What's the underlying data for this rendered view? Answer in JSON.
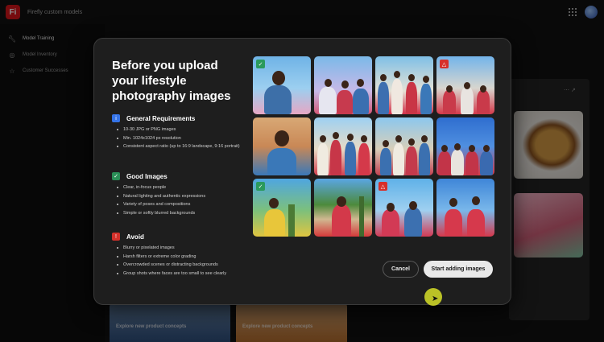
{
  "app": {
    "logo_text": "Fi",
    "title": "Firefly custom models"
  },
  "sidebar": {
    "items": [
      {
        "label": "Model Training",
        "icon": "wrench-icon",
        "active": true
      },
      {
        "label": "Model Inventory",
        "icon": "cube-icon",
        "active": false
      },
      {
        "label": "Customer Successes",
        "icon": "star-icon",
        "active": false
      }
    ]
  },
  "background": {
    "cards": [
      {
        "title": "Explore new product concepts"
      },
      {
        "title": "Explore new product concepts"
      }
    ]
  },
  "modal": {
    "title": "Before you upload your lifestyle photography images",
    "sections": [
      {
        "title": "General Requirements",
        "icon": "info-icon",
        "color": "#3574e8",
        "items": [
          "10-30 JPG or PNG images",
          "Min. 1024x1024 px resolution",
          "Consistent aspect ratio (up to 16:9 landscape, 9:16 portrait)"
        ]
      },
      {
        "title": "Good Images",
        "icon": "check-icon",
        "color": "#2a8f57",
        "items": [
          "Clear, in-focus people",
          "Natural lighting and authentic expressions",
          "Variety of poses and compositions",
          "Simple or softly blurred backgrounds"
        ]
      },
      {
        "title": "Avoid",
        "icon": "warning-icon",
        "color": "#d3302a",
        "items": [
          "Blurry or pixelated images",
          "Harsh filters or extreme color grading",
          "Overcrowded scenes or distracting backgrounds",
          "Group shots where faces are too small to see clearly"
        ]
      }
    ],
    "photos": [
      {
        "badge": "good"
      },
      {
        "badge": null
      },
      {
        "badge": null
      },
      {
        "badge": "avoid"
      },
      {
        "badge": null
      },
      {
        "badge": null
      },
      {
        "badge": null
      },
      {
        "badge": null
      },
      {
        "badge": "good"
      },
      {
        "badge": null
      },
      {
        "badge": "avoid"
      },
      {
        "badge": null
      }
    ],
    "cancel_label": "Cancel",
    "start_label": "Start adding images"
  }
}
